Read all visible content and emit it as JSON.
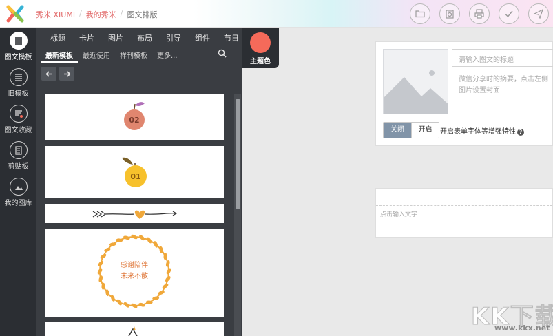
{
  "header": {
    "logo": "xiumi-x-logo",
    "breadcrumb": {
      "brand": "秀米 XIUMI",
      "my_xiumi": "我的秀米",
      "current": "图文排版",
      "separator": "/"
    },
    "actions": [
      "folder-icon",
      "preview-icon",
      "print-icon",
      "check-icon",
      "send-icon"
    ]
  },
  "rail": {
    "items": [
      {
        "label": "图文模板",
        "icon": "list-icon",
        "active": true
      },
      {
        "label": "旧模板",
        "icon": "list-icon",
        "active": false
      },
      {
        "label": "图文收藏",
        "icon": "favorite-list-icon",
        "active": false
      },
      {
        "label": "剪贴板",
        "icon": "clipboard-icon",
        "active": false
      },
      {
        "label": "我的图库",
        "icon": "image-icon",
        "active": false
      }
    ]
  },
  "panel": {
    "categories": [
      "标题",
      "卡片",
      "图片",
      "布局",
      "引导",
      "组件",
      "节日"
    ],
    "subtabs": [
      "最新模板",
      "最近使用",
      "样刊模板",
      "更多..."
    ],
    "active_subtab": "最新模板",
    "templates": [
      {
        "type": "apple-number",
        "number": "02",
        "color": "#e0866f"
      },
      {
        "type": "apple-number",
        "number": "01",
        "color": "#f7c12c"
      },
      {
        "type": "arrow-heart-divider"
      },
      {
        "type": "wreath",
        "line1": "感谢陪伴",
        "line2": "未来不散",
        "color": "#f0a83a"
      },
      {
        "type": "partial"
      }
    ]
  },
  "theme": {
    "label": "主题色",
    "color": "#f56a5a"
  },
  "editor": {
    "title_placeholder": "请输入图文的标题",
    "summary_placeholder": "微信分享时的摘要，点击左侧图片设置封面",
    "toggle_off": "关闭",
    "toggle_on": "开启",
    "toggle_desc": "开启表单字体等增强特性",
    "help": "?",
    "body_placeholder": "点击输入文字"
  },
  "watermark": {
    "text": "KK下载",
    "url": "www.kkx.net"
  }
}
